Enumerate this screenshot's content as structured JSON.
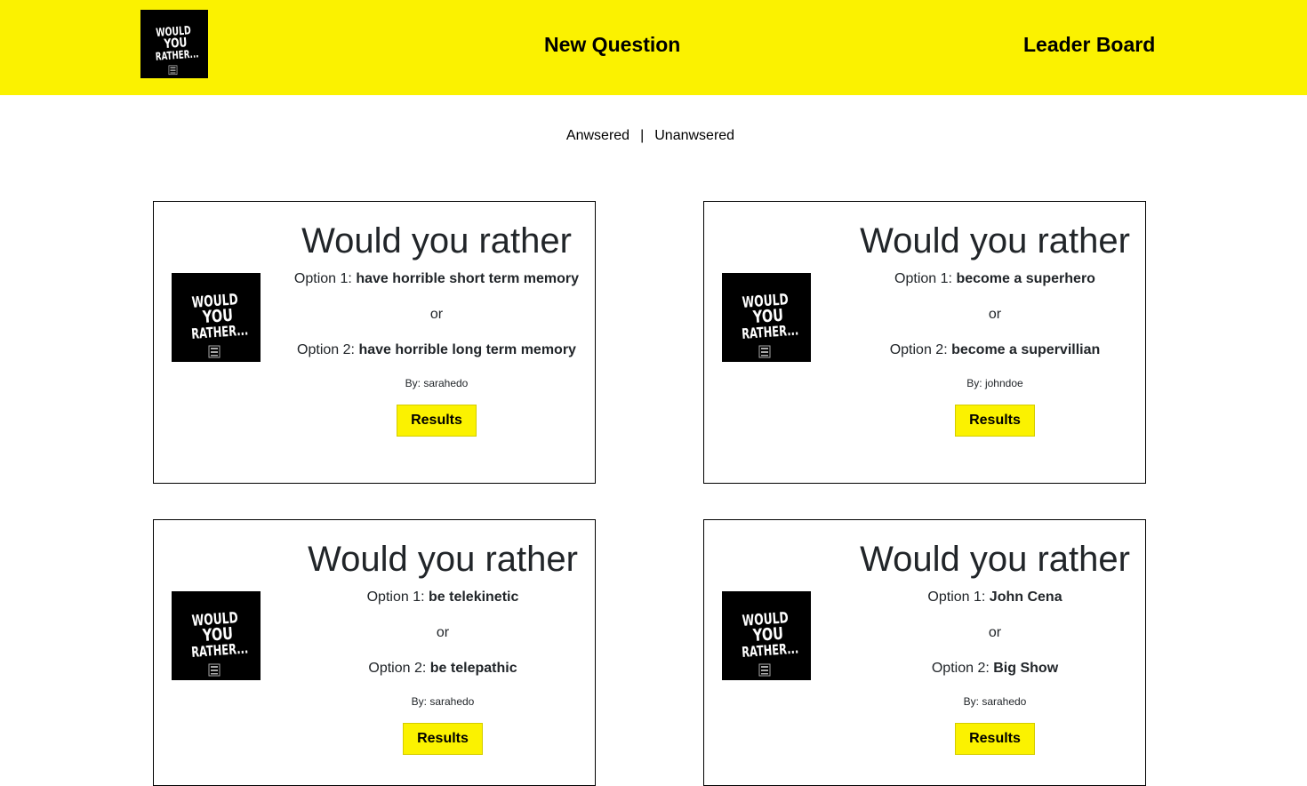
{
  "header": {
    "logo_text": [
      "WOULD",
      "YOU",
      "RATHER..."
    ],
    "nav": {
      "new_question": "New Question",
      "leader_board": "Leader Board"
    }
  },
  "filter": {
    "answered": "Anwsered",
    "separator": "|",
    "unanswered": "Unanwsered"
  },
  "colors": {
    "accent": "#fbf200",
    "text": "#212529"
  },
  "cards": [
    {
      "title": "Would you rather",
      "option1_prefix": "Option 1:",
      "option1": "have horrible short term memory",
      "or": "or",
      "option2_prefix": "Option 2:",
      "option2": "have horrible long term memory",
      "by": "By: sarahedo",
      "button": "Results"
    },
    {
      "title": "Would you rather",
      "option1_prefix": "Option 1:",
      "option1": "become a superhero",
      "or": "or",
      "option2_prefix": "Option 2:",
      "option2": "become a supervillian",
      "by": "By: johndoe",
      "button": "Results"
    },
    {
      "title": "Would you rather",
      "option1_prefix": "Option 1:",
      "option1": "be telekinetic",
      "or": "or",
      "option2_prefix": "Option 2:",
      "option2": "be telepathic",
      "by": "By: sarahedo",
      "button": "Results"
    },
    {
      "title": "Would you rather",
      "option1_prefix": "Option 1:",
      "option1": "John Cena",
      "or": "or",
      "option2_prefix": "Option 2:",
      "option2": "Big Show",
      "by": "By: sarahedo",
      "button": "Results"
    }
  ]
}
